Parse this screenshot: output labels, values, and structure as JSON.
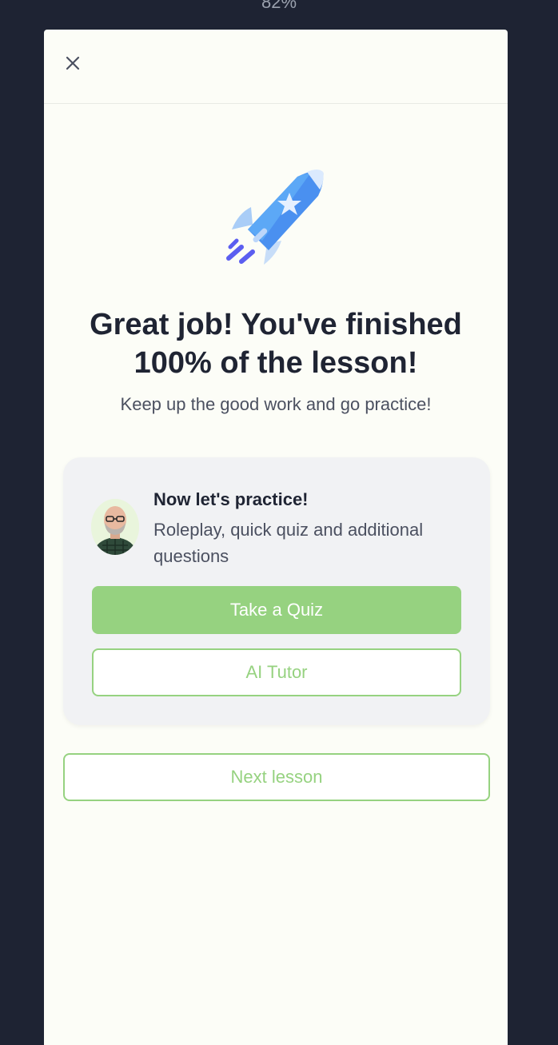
{
  "top_progress": "82%",
  "modal": {
    "close_icon": "close-icon",
    "headline": "Great job! You've finished 100% of the lesson!",
    "subline": "Keep up the good work and go practice!",
    "practice_card": {
      "title": "Now let's practice!",
      "description": "Roleplay, quick quiz and additional questions",
      "take_quiz_label": "Take a Quiz",
      "ai_tutor_label": "AI Tutor"
    },
    "next_lesson_label": "Next lesson"
  },
  "colors": {
    "backdrop": "#1e2333",
    "modal_bg": "#fcfdf7",
    "accent_green": "#96d280",
    "rocket_blue": "#3b82f6",
    "text_dark": "#1f2433"
  }
}
